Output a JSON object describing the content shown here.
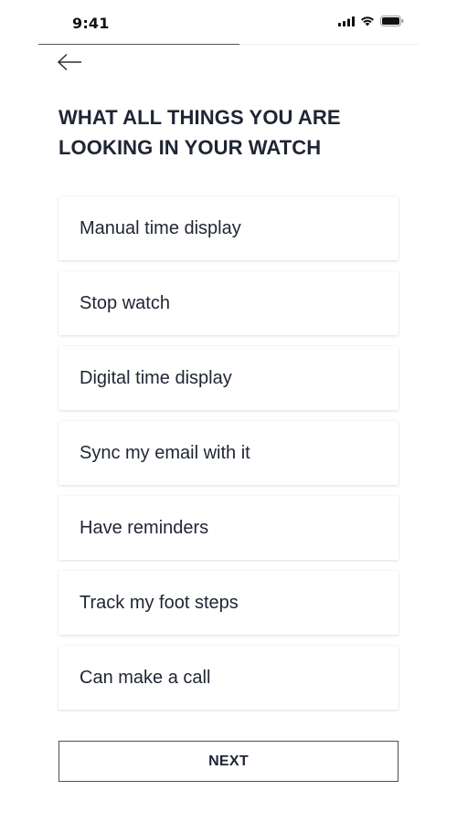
{
  "status_bar": {
    "time": "9:41",
    "icons": [
      "cellular-signal-icon",
      "wifi-icon",
      "battery-icon"
    ]
  },
  "progress": {
    "fraction": 0.53,
    "color": "#555555"
  },
  "navigation": {
    "back_icon": "arrow-left-icon"
  },
  "page": {
    "title": "WHAT ALL THINGS YOU ARE LOOKING IN YOUR WATCH"
  },
  "options": [
    {
      "label": "Manual time display"
    },
    {
      "label": "Stop watch"
    },
    {
      "label": "Digital time display"
    },
    {
      "label": "Sync my email with it"
    },
    {
      "label": "Have reminders"
    },
    {
      "label": "Track my foot steps"
    },
    {
      "label": "Can make a call"
    }
  ],
  "footer": {
    "next_label": "NEXT"
  },
  "colors": {
    "text": "#1f2533",
    "background": "#ffffff",
    "border": "#4a4f5a"
  }
}
